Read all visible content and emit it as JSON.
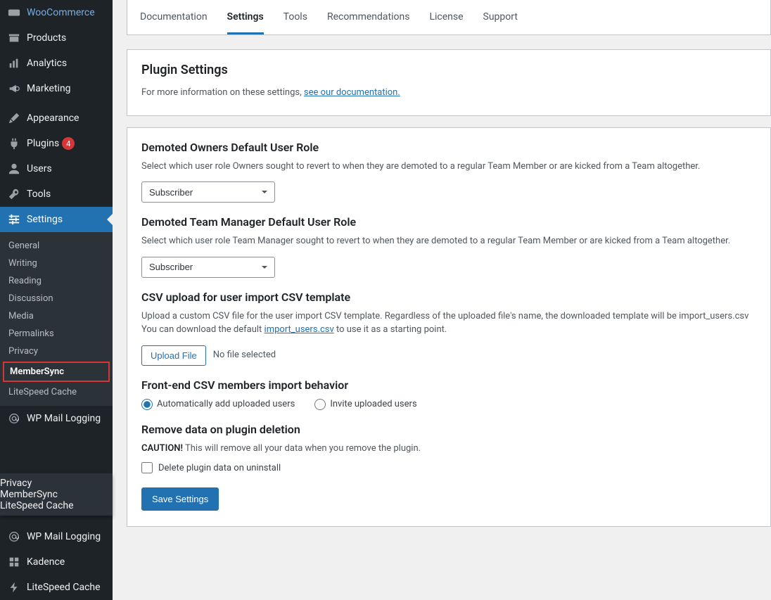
{
  "sidebar": {
    "main_items": [
      {
        "label": "WooCommerce",
        "icon": "woo"
      },
      {
        "label": "Products",
        "icon": "archive"
      },
      {
        "label": "Analytics",
        "icon": "chart"
      },
      {
        "label": "Marketing",
        "icon": "megaphone"
      },
      {
        "label": "Appearance",
        "icon": "brush"
      },
      {
        "label": "Plugins",
        "icon": "plug",
        "badge": "4"
      },
      {
        "label": "Users",
        "icon": "user"
      },
      {
        "label": "Tools",
        "icon": "wrench"
      },
      {
        "label": "Settings",
        "icon": "sliders",
        "active": true
      }
    ],
    "sub_items": [
      {
        "label": "General"
      },
      {
        "label": "Writing"
      },
      {
        "label": "Reading"
      },
      {
        "label": "Discussion"
      },
      {
        "label": "Media"
      },
      {
        "label": "Permalinks"
      },
      {
        "label": "Privacy"
      },
      {
        "label": "MemberSync",
        "boxed": true
      },
      {
        "label": "LiteSpeed Cache"
      }
    ],
    "after_items": [
      {
        "label": "WP Mail Logging",
        "icon": "at"
      }
    ],
    "float_items": [
      {
        "label": "Privacy"
      },
      {
        "label": "MemberSync",
        "current": true
      },
      {
        "label": "LiteSpeed Cache"
      }
    ],
    "bottom_items": [
      {
        "label": "WP Mail Logging",
        "icon": "at"
      },
      {
        "label": "Kadence",
        "icon": "kadence"
      },
      {
        "label": "LiteSpeed Cache",
        "icon": "bolt"
      }
    ]
  },
  "tabs": [
    {
      "label": "Documentation"
    },
    {
      "label": "Settings",
      "active": true
    },
    {
      "label": "Tools"
    },
    {
      "label": "Recommendations"
    },
    {
      "label": "License"
    },
    {
      "label": "Support"
    }
  ],
  "intro": {
    "heading": "Plugin Settings",
    "text": "For more information on these settings, ",
    "link": "see our documentation."
  },
  "section1": {
    "heading": "Demoted Owners Default User Role",
    "desc": "Select which user role Owners sought to revert to when they are demoted to a regular Team Member or are kicked from a Team altogether.",
    "value": "Subscriber"
  },
  "section2": {
    "heading": "Demoted Team Manager Default User Role",
    "desc": "Select which user role Team Manager sought to revert to when they are demoted to a regular Team Member or are kicked from a Team altogether.",
    "value": "Subscriber"
  },
  "section3": {
    "heading": "CSV upload for user import CSV template",
    "desc1": "Upload a custom CSV file for the user import CSV template. Regardless of the uploaded file's name, the downloaded template will be import_users.csv",
    "desc2a": "You can download the default ",
    "link": "import_users.csv",
    "desc2b": " to use it as a starting point.",
    "button": "Upload File",
    "status": "No file selected"
  },
  "section4": {
    "heading": "Front-end CSV members import behavior",
    "opt1": "Automatically add uploaded users",
    "opt2": "Invite uploaded users"
  },
  "section5": {
    "heading": "Remove data on plugin deletion",
    "caution": "CAUTION!",
    "desc": " This will remove all your data when you remove the plugin.",
    "check": "Delete plugin data on uninstall"
  },
  "save": "Save Settings"
}
